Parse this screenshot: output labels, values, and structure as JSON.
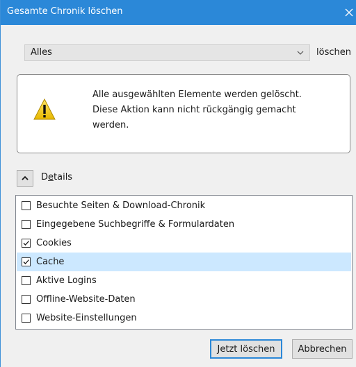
{
  "window": {
    "title": "Gesamte Chronik löschen",
    "accent_color": "#2b88d8",
    "close_icon": "close-icon"
  },
  "timerange": {
    "selected": "Alles",
    "suffix_label": "löschen"
  },
  "warning": {
    "icon": "warning-icon",
    "line1": "Alle ausgewählten Elemente werden gelöscht.",
    "line2": "Diese Aktion kann nicht rückgängig gemacht werden."
  },
  "details": {
    "label_prefix": "D",
    "label_underlined": "e",
    "label_rest": "tails",
    "expanded": true
  },
  "items": [
    {
      "label": "Besuchte Seiten & Download-Chronik",
      "checked": false,
      "selected": false
    },
    {
      "label": "Eingegebene Suchbegriffe & Formulardaten",
      "checked": false,
      "selected": false
    },
    {
      "label": "Cookies",
      "checked": true,
      "selected": false
    },
    {
      "label": "Cache",
      "checked": true,
      "selected": true
    },
    {
      "label": "Aktive Logins",
      "checked": false,
      "selected": false
    },
    {
      "label": "Offline-Website-Daten",
      "checked": false,
      "selected": false
    },
    {
      "label": "Website-Einstellungen",
      "checked": false,
      "selected": false
    }
  ],
  "buttons": {
    "clear_now": "Jetzt löschen",
    "cancel": "Abbrechen"
  }
}
